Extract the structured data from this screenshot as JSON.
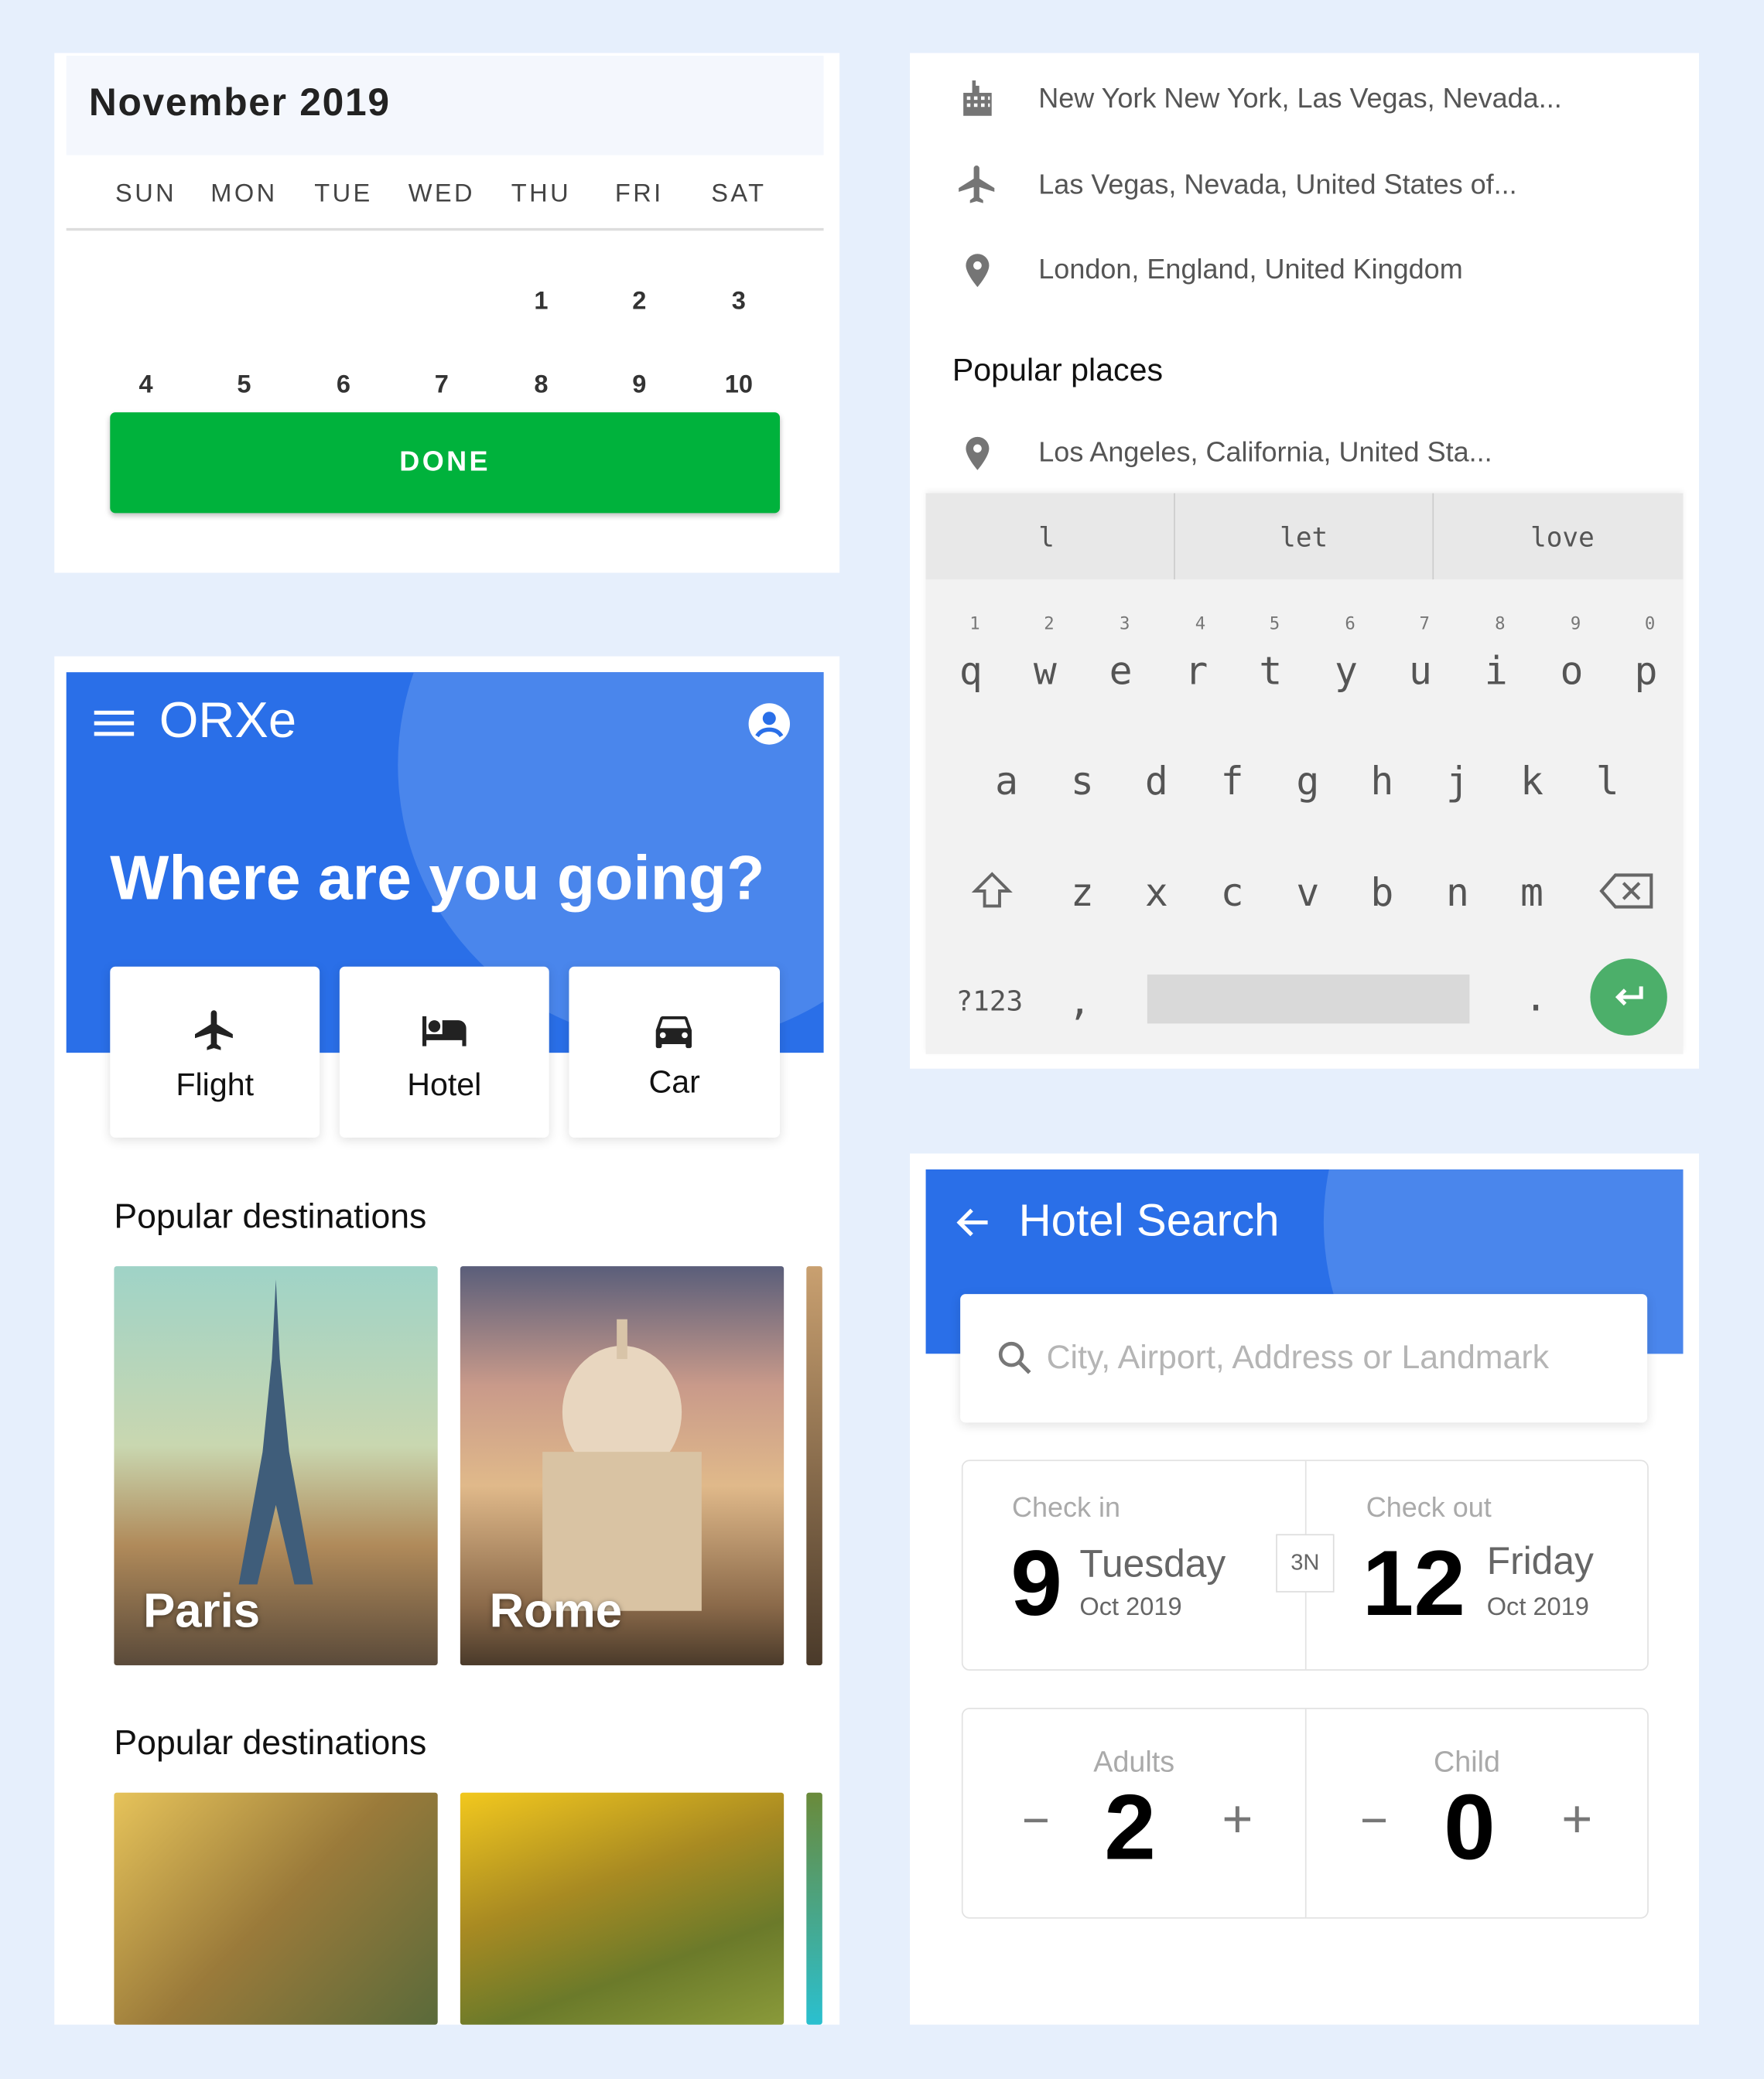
{
  "calendar": {
    "title": "November 2019",
    "weekdays": [
      "SUN",
      "MON",
      "TUE",
      "WED",
      "THU",
      "FRI",
      "SAT"
    ],
    "row1": [
      "1",
      "2",
      "3"
    ],
    "row2": [
      "4",
      "5",
      "6",
      "7",
      "8",
      "9",
      "10"
    ],
    "done_label": "DONE",
    "accent": "#00b23c"
  },
  "home": {
    "app_name": "ORXe",
    "heading": "Where are you going?",
    "categories": [
      {
        "label": "Flight"
      },
      {
        "label": "Hotel"
      },
      {
        "label": "Car"
      }
    ],
    "section1": "Popular destinations",
    "destinations": [
      {
        "label": "Paris"
      },
      {
        "label": "Rome"
      }
    ],
    "section2": "Popular destinations",
    "brand_color": "#2a6fe8"
  },
  "search": {
    "recent": [
      {
        "icon": "building-icon",
        "text": "New York New York, Las Vegas, Nevada..."
      },
      {
        "icon": "airplane-icon",
        "text": "Las Vegas, Nevada, United States of..."
      },
      {
        "icon": "location-pin-icon",
        "text": "London, England, United Kingdom"
      }
    ],
    "popular_title": "Popular places",
    "popular": [
      {
        "icon": "location-pin-icon",
        "text": "Los Angeles, California, United Sta..."
      }
    ]
  },
  "keyboard": {
    "suggestions": [
      "l",
      "let",
      "love"
    ],
    "row1": [
      "q",
      "w",
      "e",
      "r",
      "t",
      "y",
      "u",
      "i",
      "o",
      "p"
    ],
    "row1_hints": [
      "1",
      "2",
      "3",
      "4",
      "5",
      "6",
      "7",
      "8",
      "9",
      "0"
    ],
    "row2": [
      "a",
      "s",
      "d",
      "f",
      "g",
      "h",
      "j",
      "k",
      "l"
    ],
    "row3": [
      "z",
      "x",
      "c",
      "v",
      "b",
      "n",
      "m"
    ],
    "symbols_label": "?123",
    "comma": ",",
    "period": "."
  },
  "hotel": {
    "title": "Hotel Search",
    "search_placeholder": "City, Airport, Address or Landmark",
    "checkin": {
      "label": "Check in",
      "day": "9",
      "weekday": "Tuesday",
      "month": "Oct 2019"
    },
    "nights": "3N",
    "checkout": {
      "label": "Check out",
      "day": "12",
      "weekday": "Friday",
      "month": "Oct 2019"
    },
    "adults": {
      "label": "Adults",
      "value": "2",
      "minus": "−",
      "plus": "+"
    },
    "child": {
      "label": "Child",
      "value": "0",
      "minus": "−",
      "plus": "+"
    }
  }
}
